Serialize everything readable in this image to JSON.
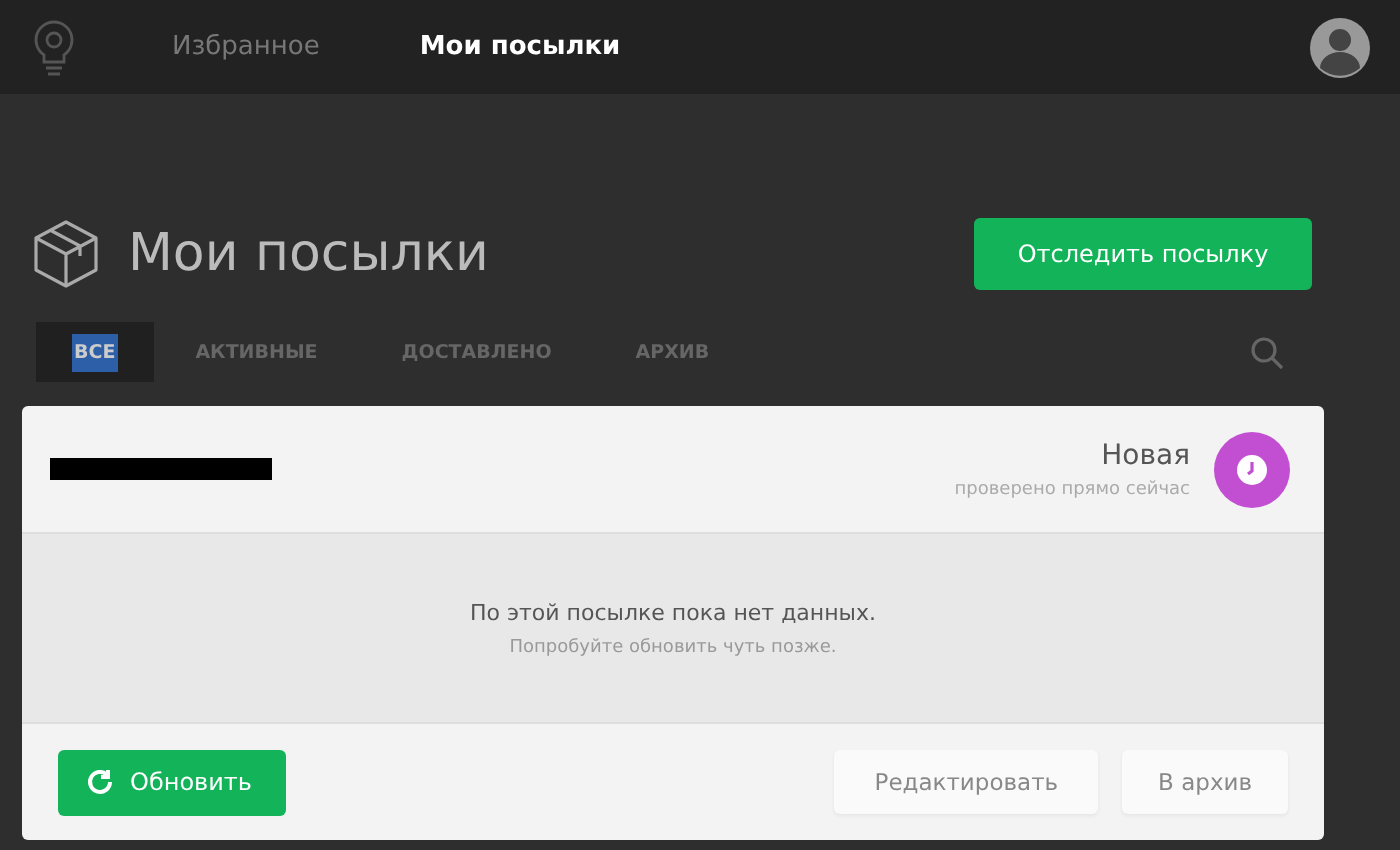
{
  "nav": {
    "items": [
      {
        "label": "Избранное",
        "selected": false
      },
      {
        "label": "Мои посылки",
        "selected": true
      }
    ]
  },
  "page": {
    "title": "Мои посылки",
    "track_button": "Отследить посылку"
  },
  "tabs": [
    {
      "label": "ВСЕ",
      "selected": true,
      "highlighted": true
    },
    {
      "label": "АКТИВНЫЕ",
      "selected": false,
      "highlighted": false
    },
    {
      "label": "ДОСТАВЛЕНО",
      "selected": false,
      "highlighted": false
    },
    {
      "label": "АРХИВ",
      "selected": false,
      "highlighted": false
    }
  ],
  "parcel": {
    "number_redacted": true,
    "status": "Новая",
    "checked": "проверено прямо сейчас",
    "message": "По этой посылке пока нет данных.",
    "hint": "Попробуйте обновить чуть позже.",
    "refresh_button": "Обновить",
    "edit_button": "Редактировать",
    "archive_button": "В архив"
  }
}
